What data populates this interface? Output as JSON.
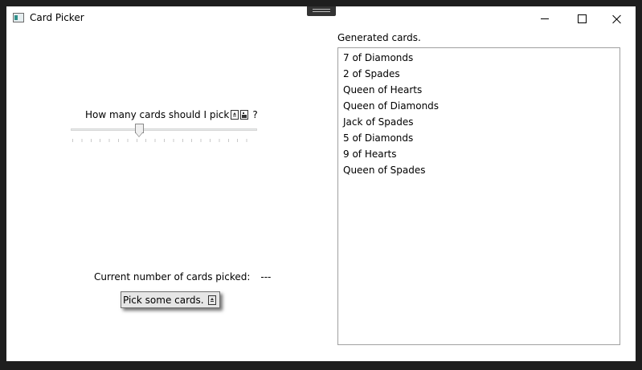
{
  "window": {
    "title": "Card Picker",
    "icons": {
      "app": "app-window-icon",
      "minimize": "minimize-icon",
      "maximize": "maximize-icon",
      "close": "close-icon"
    }
  },
  "left_panel": {
    "prompt": "How many cards should I pick",
    "prompt_suffix": "?",
    "slider": {
      "value_fraction": 0.36,
      "tick_count": 21
    },
    "count_label": "Current number of cards picked:",
    "count_value": "---",
    "pick_button": {
      "label": "Pick some cards."
    }
  },
  "right_panel": {
    "label": "Generated cards.",
    "cards": [
      "7 of Diamonds",
      "2 of Spades",
      "Queen of Hearts",
      "Queen of Diamonds",
      "Jack of Spades",
      "5 of Diamonds",
      "9 of Hearts",
      "Queen of Spades"
    ]
  }
}
